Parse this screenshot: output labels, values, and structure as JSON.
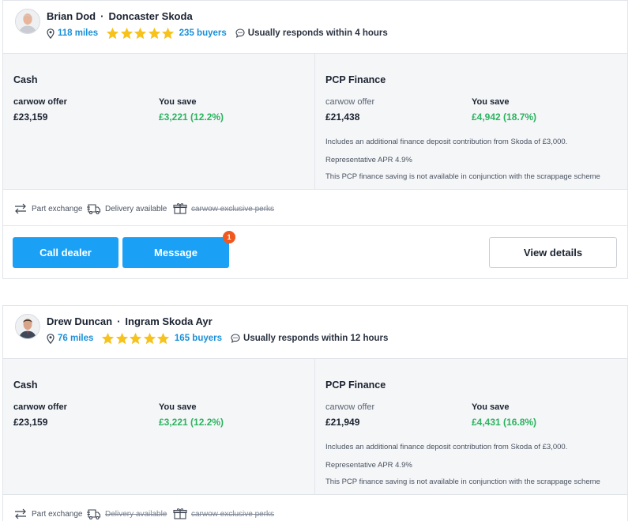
{
  "dealers": [
    {
      "name": "Brian Dod",
      "dealership": "Doncaster Skoda",
      "distance": "118 miles",
      "rating_stars": 5,
      "buyers": "235 buyers",
      "response": "Usually responds within 4 hours",
      "cash": {
        "title": "Cash",
        "offer_label": "carwow offer",
        "offer_value": "£23,159",
        "save_label": "You save",
        "save_value": "£3,221 (12.2%)"
      },
      "pcp": {
        "title": "PCP Finance",
        "offer_label": "carwow offer",
        "offer_value": "£21,438",
        "save_label": "You save",
        "save_value": "£4,942 (18.7%)",
        "notes": [
          "Includes an additional finance deposit contribution from Skoda of £3,000.",
          "Representative APR 4.9%",
          "This PCP finance saving is not available in conjunction with the scrappage scheme"
        ]
      },
      "perks": [
        {
          "label": "Part exchange",
          "available": true,
          "icon": "swap-arrows-icon"
        },
        {
          "label": "Delivery available",
          "available": true,
          "icon": "delivery-truck-icon"
        },
        {
          "label": "carwow exclusive perks",
          "available": false,
          "icon": "gift-icon"
        }
      ],
      "actions": {
        "call_label": "Call dealer",
        "message_label": "Message",
        "message_badge": "1",
        "details_label": "View details"
      }
    },
    {
      "name": "Drew Duncan",
      "dealership": "Ingram Skoda Ayr",
      "distance": "76 miles",
      "rating_stars": 5,
      "buyers": "165 buyers",
      "response": "Usually responds within 12 hours",
      "cash": {
        "title": "Cash",
        "offer_label": "carwow offer",
        "offer_value": "£23,159",
        "save_label": "You save",
        "save_value": "£3,221 (12.2%)"
      },
      "pcp": {
        "title": "PCP Finance",
        "offer_label": "carwow offer",
        "offer_value": "£21,949",
        "save_label": "You save",
        "save_value": "£4,431 (16.8%)",
        "notes": [
          "Includes an additional finance deposit contribution from Skoda of £3,000.",
          "Representative APR 4.9%",
          "This PCP finance saving is not available in conjunction with the scrappage scheme"
        ]
      },
      "perks": [
        {
          "label": "Part exchange",
          "available": true,
          "icon": "swap-arrows-icon"
        },
        {
          "label": "Delivery available",
          "available": false,
          "icon": "delivery-truck-icon"
        },
        {
          "label": "carwow exclusive perks",
          "available": false,
          "icon": "gift-icon"
        }
      ]
    }
  ],
  "colors": {
    "link_blue": "#1a8fd8",
    "star_yellow": "#f7c21b",
    "saving_green": "#2cb35f",
    "button_blue": "#1aa0f5",
    "badge_orange": "#f0581f"
  }
}
